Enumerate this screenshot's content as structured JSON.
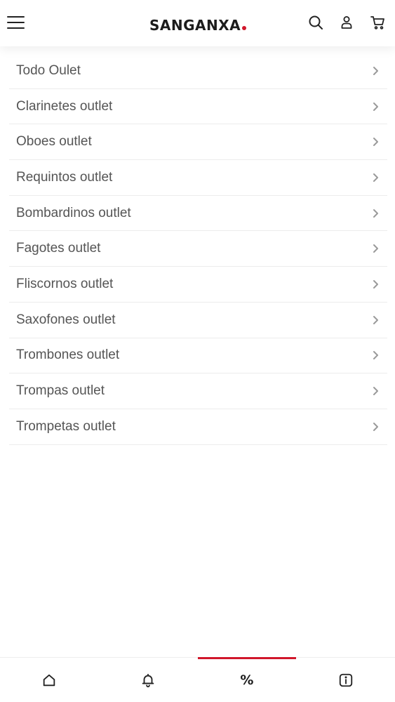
{
  "header": {
    "brand": "SANGANXA",
    "accent_color": "#d1172b",
    "icons": [
      "menu-icon",
      "search-icon",
      "user-icon",
      "cart-icon"
    ]
  },
  "categories": [
    "Todo Oulet",
    "Clarinetes outlet",
    "Oboes outlet",
    "Requintos outlet",
    "Bombardinos outlet",
    "Fagotes outlet",
    "Fliscornos outlet",
    "Saxofones outlet",
    "Trombones outlet",
    "Trompas outlet",
    "Trompetas outlet"
  ],
  "bottom_nav": {
    "items": [
      "home-icon",
      "bell-icon",
      "percent-icon",
      "info-icon"
    ],
    "percent_symbol": "%",
    "active_index": 2
  }
}
